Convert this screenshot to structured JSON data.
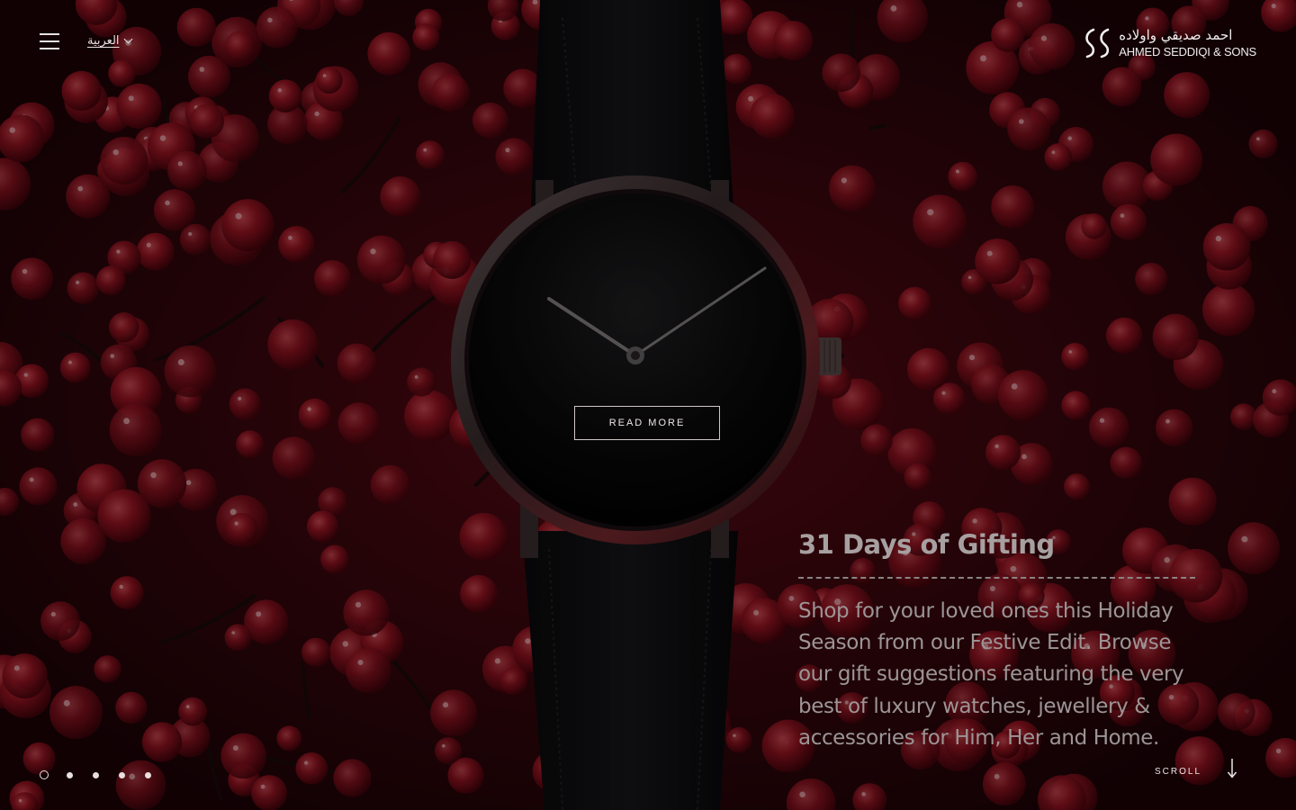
{
  "header": {
    "menu_icon": "hamburger-icon",
    "language_label": "العربية",
    "logo_arabic": "احمد صديقي واولاده",
    "logo_english": "AHMED SEDDIQI & SONS"
  },
  "hero": {
    "read_more_label": "READ MORE",
    "title": "31 Days of Gifting",
    "description": "Shop for your loved ones this Holiday Season from our Festive Edit. Browse our gift suggestions featuring the very best of luxury watches, jewellery & accessories for Him, Her and Home."
  },
  "pager": {
    "slides": 5,
    "active_index": 0
  },
  "scroll": {
    "label": "SCROLL",
    "icon": "arrow-down-icon"
  },
  "colors": {
    "background": "#2a0509",
    "berry": "#9e1524",
    "text_light": "#eee6e6",
    "text_muted": "#a7a0a1"
  }
}
